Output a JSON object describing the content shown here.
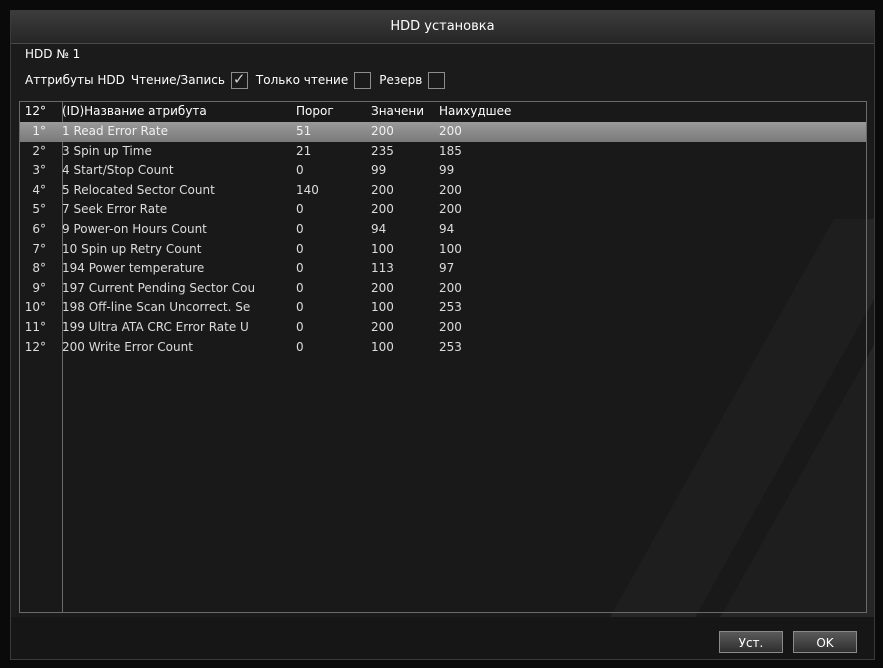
{
  "dialog": {
    "title": "HDD установка"
  },
  "hdd": {
    "number_label": "HDD № 1"
  },
  "attributes": {
    "label": "Аттрибуты HDD",
    "options": [
      {
        "label": "Чтение/Запись",
        "checked": true
      },
      {
        "label": "Только чтение",
        "checked": false
      },
      {
        "label": "Резерв",
        "checked": false
      }
    ]
  },
  "table": {
    "columns": {
      "idx": "12°",
      "name": "(ID)Название атрибута",
      "threshold": "Порог",
      "value": "Значени",
      "worst": "Наихудшее"
    },
    "rows": [
      {
        "idx": "1°",
        "name": "1 Read Error Rate",
        "threshold": "51",
        "value": "200",
        "worst": "200",
        "selected": true
      },
      {
        "idx": "2°",
        "name": "3 Spin up Time",
        "threshold": "21",
        "value": "235",
        "worst": "185",
        "selected": false
      },
      {
        "idx": "3°",
        "name": "4 Start/Stop Count",
        "threshold": "0",
        "value": "99",
        "worst": "99",
        "selected": false
      },
      {
        "idx": "4°",
        "name": "5 Relocated Sector Count",
        "threshold": "140",
        "value": "200",
        "worst": "200",
        "selected": false
      },
      {
        "idx": "5°",
        "name": "7 Seek Error Rate",
        "threshold": "0",
        "value": "200",
        "worst": "200",
        "selected": false
      },
      {
        "idx": "6°",
        "name": "9 Power-on Hours Count",
        "threshold": "0",
        "value": "94",
        "worst": "94",
        "selected": false
      },
      {
        "idx": "7°",
        "name": "10 Spin up Retry Count",
        "threshold": "0",
        "value": "100",
        "worst": "100",
        "selected": false
      },
      {
        "idx": "8°",
        "name": "194 Power temperature",
        "threshold": "0",
        "value": "113",
        "worst": "97",
        "selected": false
      },
      {
        "idx": "9°",
        "name": "197 Current Pending Sector Cou",
        "threshold": "0",
        "value": "200",
        "worst": "200",
        "selected": false
      },
      {
        "idx": "10°",
        "name": "198 Off-line Scan Uncorrect. Se",
        "threshold": "0",
        "value": "100",
        "worst": "253",
        "selected": false
      },
      {
        "idx": "11°",
        "name": "199 Ultra ATA CRC Error Rate U",
        "threshold": "0",
        "value": "200",
        "worst": "200",
        "selected": false
      },
      {
        "idx": "12°",
        "name": "200 Write Error Count",
        "threshold": "0",
        "value": "100",
        "worst": "253",
        "selected": false
      }
    ]
  },
  "buttons": {
    "apply": "Уст.",
    "ok": "OK"
  }
}
